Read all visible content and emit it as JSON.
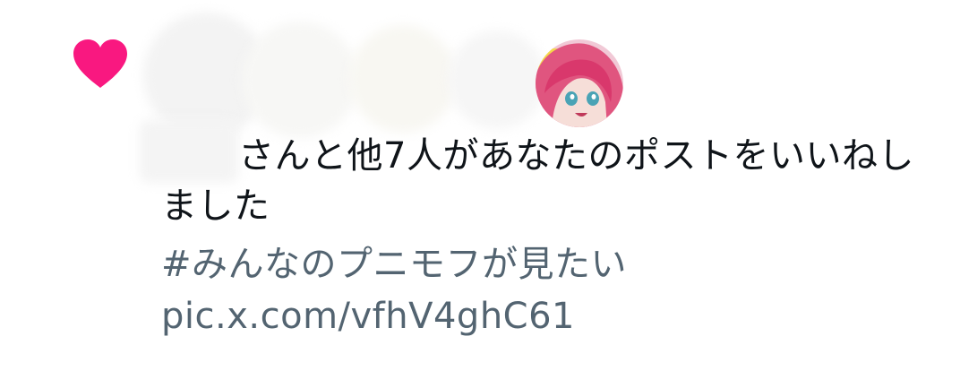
{
  "notification": {
    "icon": "heart-icon",
    "icon_color": "#f91880",
    "message_suffix": "さんと他7人があなたのポストをいいねしました",
    "tweet": {
      "hashtag": "#みんなのプニモフが見たい",
      "link": "pic.x.com/vfhV4ghC61"
    }
  },
  "colors": {
    "text_primary": "#0f1419",
    "text_secondary": "#536471",
    "like_pink": "#f91880"
  }
}
